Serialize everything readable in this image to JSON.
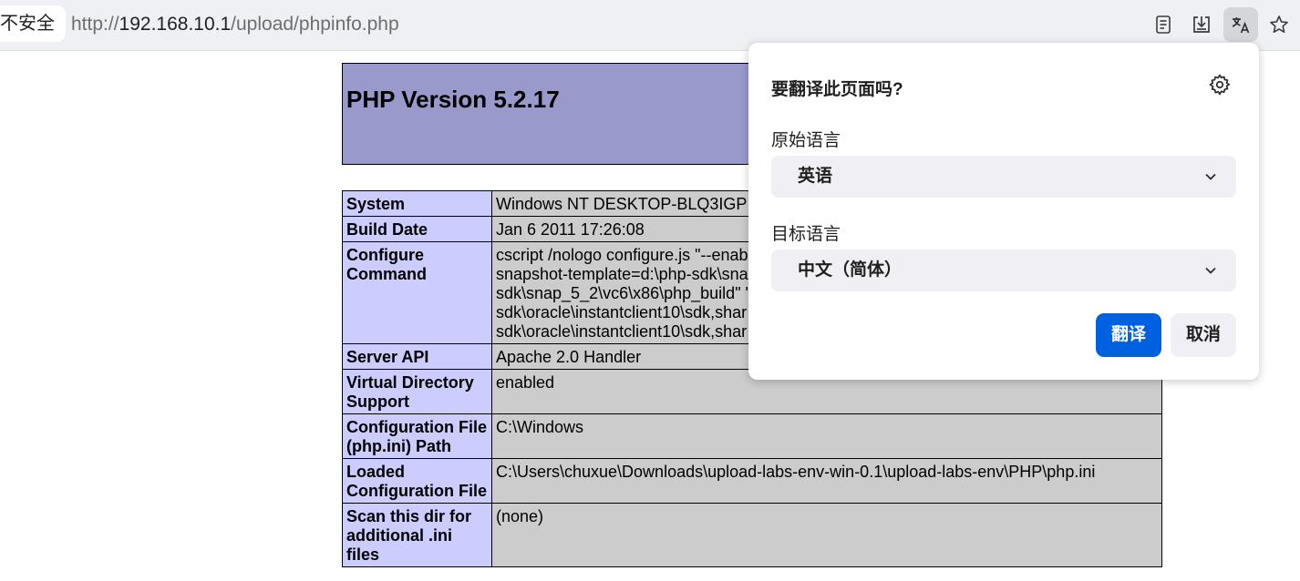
{
  "browser": {
    "security_label": "不安全",
    "url_scheme": "http://",
    "url_host": "192.168.10.1",
    "url_path": "/upload/phpinfo.php",
    "toolbar_icons": [
      "reader-view-icon",
      "download-icon",
      "translate-icon",
      "bookmark-star-icon"
    ]
  },
  "phpinfo": {
    "version_title": "PHP Version 5.2.17",
    "rows": [
      {
        "key": "System",
        "value": "Windows NT DESKTOP-BLQ3IGP"
      },
      {
        "key": "Build Date",
        "value": "Jan 6 2011 17:26:08"
      },
      {
        "key": "Configure Command",
        "value": "cscript /nologo configure.js \"--enab\nsnapshot-template=d:\\php-sdk\\sna\nsdk\\snap_5_2\\vc6\\x86\\php_build\" \"\nsdk\\oracle\\instantclient10\\sdk,shar\nsdk\\oracle\\instantclient10\\sdk,shar"
      },
      {
        "key": "Server API",
        "value": "Apache 2.0 Handler"
      },
      {
        "key": "Virtual Directory Support",
        "value": "enabled"
      },
      {
        "key": "Configuration File (php.ini) Path",
        "value": "C:\\Windows"
      },
      {
        "key": "Loaded Configuration File",
        "value": "C:\\Users\\chuxue\\Downloads\\upload-labs-env-win-0.1\\upload-labs-env\\PHP\\php.ini"
      },
      {
        "key": "Scan this dir for additional .ini files",
        "value": "(none)"
      }
    ]
  },
  "translate_popup": {
    "title": "要翻译此页面吗?",
    "source_label": "原始语言",
    "source_value": "英语",
    "target_label": "目标语言",
    "target_value": "中文（简体）",
    "translate_button": "翻译",
    "cancel_button": "取消",
    "accent_color": "#0061e0"
  }
}
